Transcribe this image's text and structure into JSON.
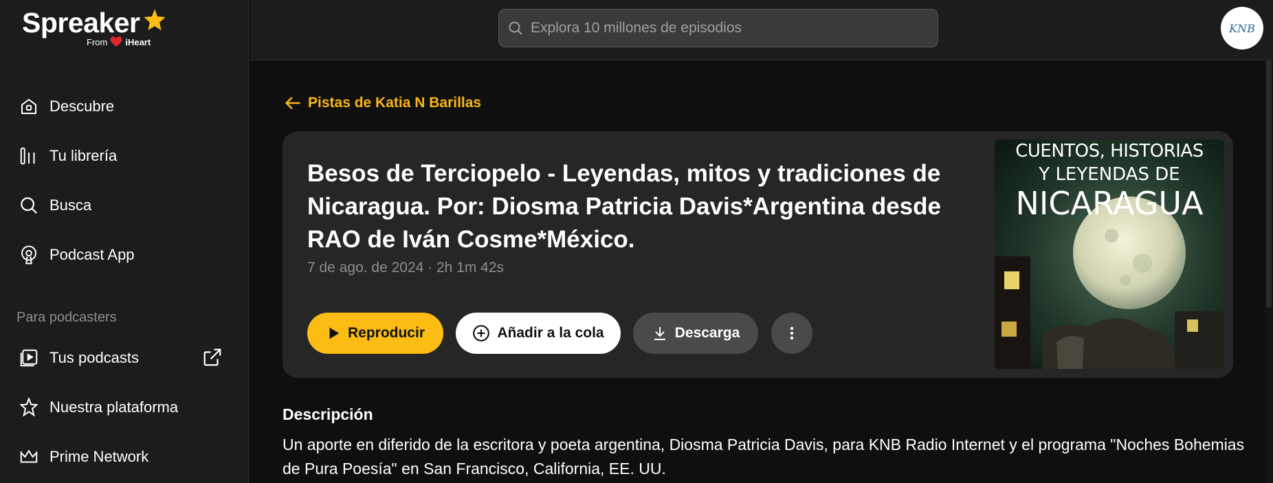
{
  "app": {
    "logo_text": "Spreaker",
    "logo_from": "From",
    "logo_partner": "iHeart",
    "accent_color": "#fbbd13"
  },
  "sidebar": {
    "items": [
      {
        "label": "Descubre",
        "icon": "home-icon"
      },
      {
        "label": "Tu librería",
        "icon": "library-icon"
      },
      {
        "label": "Busca",
        "icon": "search-icon"
      },
      {
        "label": "Podcast App",
        "icon": "podcast-icon"
      }
    ],
    "section_title": "Para podcasters",
    "podcaster_items": [
      {
        "label": "Tus podcasts",
        "icon": "play-square-icon"
      },
      {
        "label": "Nuestra plataforma",
        "icon": "star-outline-icon"
      },
      {
        "label": "Prime Network",
        "icon": "crown-icon"
      }
    ]
  },
  "search": {
    "placeholder": "Explora 10 millones de episodios"
  },
  "user": {
    "avatar_text": "KNB"
  },
  "back_link": {
    "label": "Pistas de Katia N Barillas"
  },
  "episode": {
    "title": "Besos de Terciopelo - Leyendas, mitos y tradiciones de Nicaragua. Por: Diosma Patricia Davis*Argentina desde RAO de Iván Cosme*México.",
    "meta": "7 de ago. de 2024 · 2h 1m 42s",
    "cover_line1": "CUENTOS, HISTORIAS",
    "cover_line2": "Y LEYENDAS DE",
    "cover_line3": "NICARAGUA"
  },
  "actions": {
    "play": "Reproducir",
    "queue": "Añadir a la cola",
    "download": "Descarga"
  },
  "description": {
    "title": "Descripción",
    "text": "Un aporte en diferido de la escritora y poeta argentina, Diosma Patricia Davis, para KNB Radio Internet y el programa \"Noches Bohemias de Pura Poesía\" en San Francisco, California, EE. UU."
  }
}
